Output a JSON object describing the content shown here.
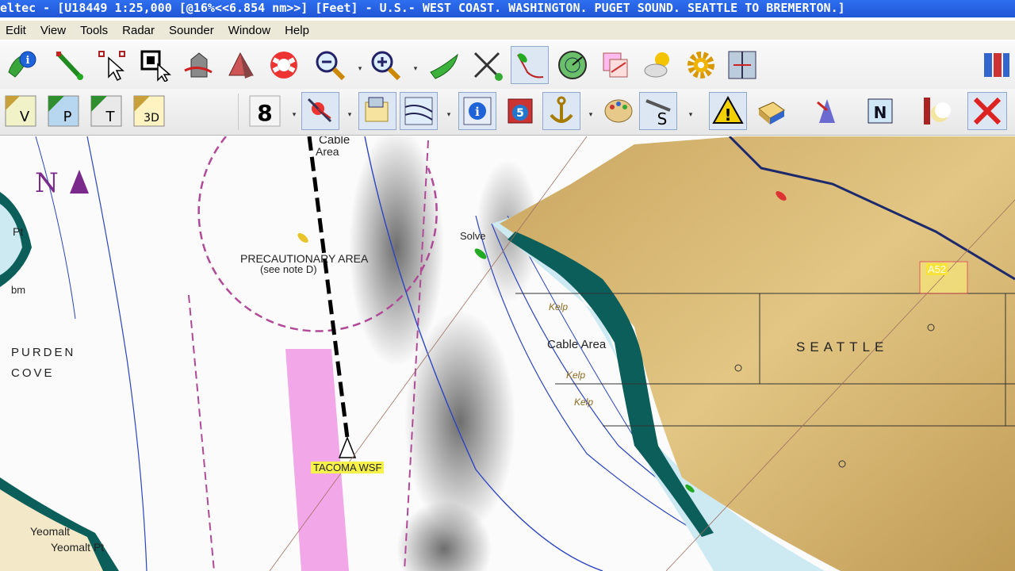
{
  "window": {
    "title": "eltec - [U18449 1:25,000 [@16%<<6.854 nm>>] [Feet] - U.S.- WEST COAST. WASHINGTON. PUGET SOUND. SEATTLE TO BREMERTON.]"
  },
  "menu": {
    "items": [
      "Edit",
      "View",
      "Tools",
      "Radar",
      "Sounder",
      "Window",
      "Help"
    ]
  },
  "toolbar_top": {
    "icons": [
      "info-icon",
      "route-pencil-icon",
      "cursor-select-icon",
      "window-select-icon",
      "3d-box-icon",
      "pyramid-icon",
      "lifebuoy-icon",
      "zoom-out-icon",
      "zoom-in-icon",
      "boat-icon",
      "cross-tools-icon",
      "route-line-icon",
      "radar-icon",
      "chart-layers-icon",
      "weather-icon",
      "settings-gear-icon",
      "split-view-icon",
      "tile-windows-icon"
    ]
  },
  "toolbar_bottom": {
    "view_buttons": [
      {
        "name": "vector-view-button",
        "letter": "V"
      },
      {
        "name": "photo-view-button",
        "letter": "P"
      },
      {
        "name": "terrain-view-button",
        "letter": "T"
      },
      {
        "name": "3d-view-button",
        "letter": "3D"
      }
    ],
    "number_button": "8",
    "tide_number": "5",
    "tools_letter": "S",
    "north_letter": "N"
  },
  "chart": {
    "labels": {
      "cable_area_top": "Cable",
      "cable_area_top2": "Area",
      "precautionary_area": "PRECAUTIONARY AREA",
      "see_note": "(see note D)",
      "spurden": "PURDEN",
      "cove": "COVE",
      "pt": "Pt",
      "bm": "bm",
      "cable_area_right": "Cable Area",
      "seattle": "SEATTLE",
      "kelp1": "Kelp",
      "kelp2": "Kelp",
      "kelp3": "Kelp",
      "tacoma_wsf": "TACOMA WSF",
      "a52": "A52",
      "yeomalt1": "Yeomalt",
      "yeomalt2": "Yeomalt Pt",
      "solve": "Solve",
      "north_marker": "N"
    },
    "colors": {
      "land": "#d8b877",
      "water": "#ffffff",
      "shallow": "#cde9f2",
      "drying": "#0c5e5a",
      "ferry_lane": "#f2a8e8",
      "caution": "#b14a96",
      "depth_line": "#2b44c2"
    }
  }
}
